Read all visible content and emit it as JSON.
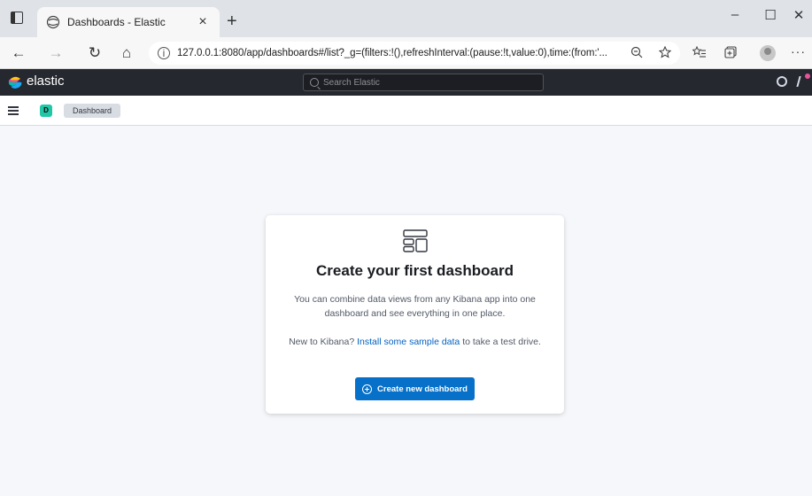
{
  "browser": {
    "tab_title": "Dashboards - Elastic",
    "tab_close": "×",
    "new_tab": "+",
    "url": "127.0.0.1:8080/app/dashboards#/list?_g=(filters:!(),refreshInterval:(pause:!t,value:0),time:(from:'...",
    "controls": {
      "minimize": "–",
      "maximize": "☐",
      "close": "✕"
    },
    "nav": {
      "back": "←",
      "forward": "→",
      "reload": "↻",
      "home": "⌂"
    },
    "more": "···"
  },
  "header": {
    "brand": "elastic",
    "search_placeholder": "Search Elastic"
  },
  "breadcrumb": {
    "space_initial": "D",
    "current": "Dashboard"
  },
  "empty_prompt": {
    "title": "Create your first dashboard",
    "body": "You can combine data views from any Kibana app into one dashboard and see everything in one place.",
    "body2_prefix": "New to Kibana? ",
    "body2_link": "Install some sample data",
    "body2_suffix": " to take a test drive.",
    "button_label": "Create new dashboard"
  },
  "colors": {
    "header_bg": "#25282f",
    "primary": "#0771c9",
    "space_avatar": "#20c7a7"
  }
}
